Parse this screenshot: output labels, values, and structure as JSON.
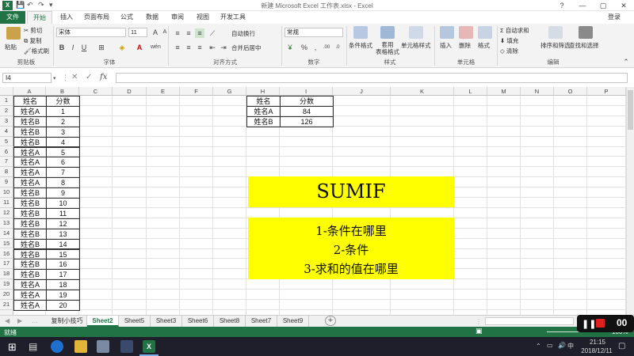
{
  "window": {
    "title": "新建 Microsoft Excel 工作表.xlsx - Excel",
    "login": "登录",
    "min": "—",
    "restore": "▢",
    "close": "✕",
    "help": "?"
  },
  "tabs": [
    "文件",
    "开始",
    "插入",
    "页面布局",
    "公式",
    "数据",
    "审阅",
    "视图",
    "开发工具"
  ],
  "ribbon": {
    "clipboard": {
      "paste": "粘贴",
      "cut": "剪切",
      "copy": "复制",
      "format_painter": "格式刷",
      "label": "剪贴板"
    },
    "font": {
      "name": "宋体",
      "size": "11",
      "bold": "B",
      "italic": "I",
      "underline": "U",
      "label": "字体",
      "grow": "A",
      "shrink": "A"
    },
    "align": {
      "wrap": "自动换行",
      "merge": "合并后居中",
      "label": "对齐方式"
    },
    "number": {
      "format": "常规",
      "percent": "%",
      "comma": ",",
      "label": "数字"
    },
    "styles": {
      "cond": "条件格式",
      "table": "套用\n表格格式",
      "cell": "单元格样式",
      "label": "样式"
    },
    "cells": {
      "insert": "插入",
      "delete": "删除",
      "format": "格式",
      "label": "单元格"
    },
    "editing": {
      "autosum": "自动求和",
      "fill": "填充",
      "clear": "清除",
      "sort": "排序和筛选",
      "find": "查找和选择",
      "label": "编辑"
    }
  },
  "formula_bar": {
    "namebox": "I4",
    "fx": "fx",
    "cancel": "✕",
    "enter": "✓",
    "value": ""
  },
  "columns": [
    "A",
    "B",
    "C",
    "D",
    "E",
    "F",
    "G",
    "H",
    "I",
    "J",
    "K",
    "L",
    "M",
    "N",
    "O",
    "P"
  ],
  "rows": [
    "1",
    "2",
    "3",
    "4",
    "5",
    "6",
    "7",
    "8",
    "9",
    "10",
    "11",
    "12",
    "13",
    "14",
    "15",
    "16",
    "17",
    "18",
    "19",
    "20",
    "21"
  ],
  "table_main": {
    "headers": [
      "姓名",
      "分数"
    ],
    "rows": [
      [
        "姓名A",
        "1"
      ],
      [
        "姓名B",
        "2"
      ],
      [
        "姓名B",
        "3"
      ],
      [
        "姓名B",
        "4"
      ],
      [
        "姓名A",
        "5"
      ],
      [
        "姓名A",
        "6"
      ],
      [
        "姓名A",
        "7"
      ],
      [
        "姓名A",
        "8"
      ],
      [
        "姓名B",
        "9"
      ],
      [
        "姓名B",
        "10"
      ],
      [
        "姓名B",
        "11"
      ],
      [
        "姓名B",
        "12"
      ],
      [
        "姓名B",
        "13"
      ],
      [
        "姓名B",
        "14"
      ],
      [
        "姓名B",
        "15"
      ],
      [
        "姓名B",
        "16"
      ],
      [
        "姓名B",
        "17"
      ],
      [
        "姓名A",
        "18"
      ],
      [
        "姓名A",
        "19"
      ],
      [
        "姓名A",
        "20"
      ]
    ]
  },
  "table_summary": {
    "headers": [
      "姓名",
      "分数"
    ],
    "rows": [
      [
        "姓名A",
        "84"
      ],
      [
        "姓名B",
        "126"
      ]
    ]
  },
  "banner_title": "SUMIF",
  "banner_lines": [
    "1-条件在哪里",
    "2-条件",
    "3-求和的值在哪里"
  ],
  "sheets": [
    "复制小技巧",
    "Sheet2",
    "Sheet5",
    "Sheet3",
    "Sheet6",
    "Sheet8",
    "Sheet7",
    "Sheet9"
  ],
  "active_sheet": "Sheet2",
  "add_sheet": "+",
  "status": {
    "ready": "就绪",
    "zoom": "100%"
  },
  "taskbar": {
    "time": "21:15",
    "date": "2018/12/11",
    "ime": "中"
  },
  "colors": {
    "accent": "#217346",
    "highlight": "#ffff00"
  }
}
